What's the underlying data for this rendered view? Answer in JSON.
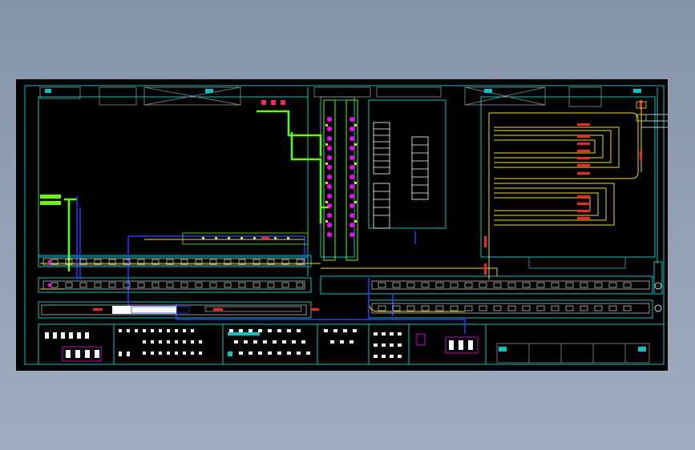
{
  "viewer": {
    "background": "#8e9bb1",
    "canvas_background": "#000000"
  },
  "drawing": {
    "kind": "CAD factory floor plan with conveyor lines",
    "line_colors": {
      "frame": "#00c8c8",
      "conveyor": "#d8d8d8",
      "yellow_pipe": "#f0e000",
      "green_pipe": "#60ff00",
      "blue_pipe": "#2040ff",
      "magenta_node": "#ff00ff",
      "red_arrow": "#ff2020",
      "white": "#ffffff"
    },
    "icons": [
      "equipment-icon",
      "arrow-icon",
      "table-icon"
    ]
  }
}
